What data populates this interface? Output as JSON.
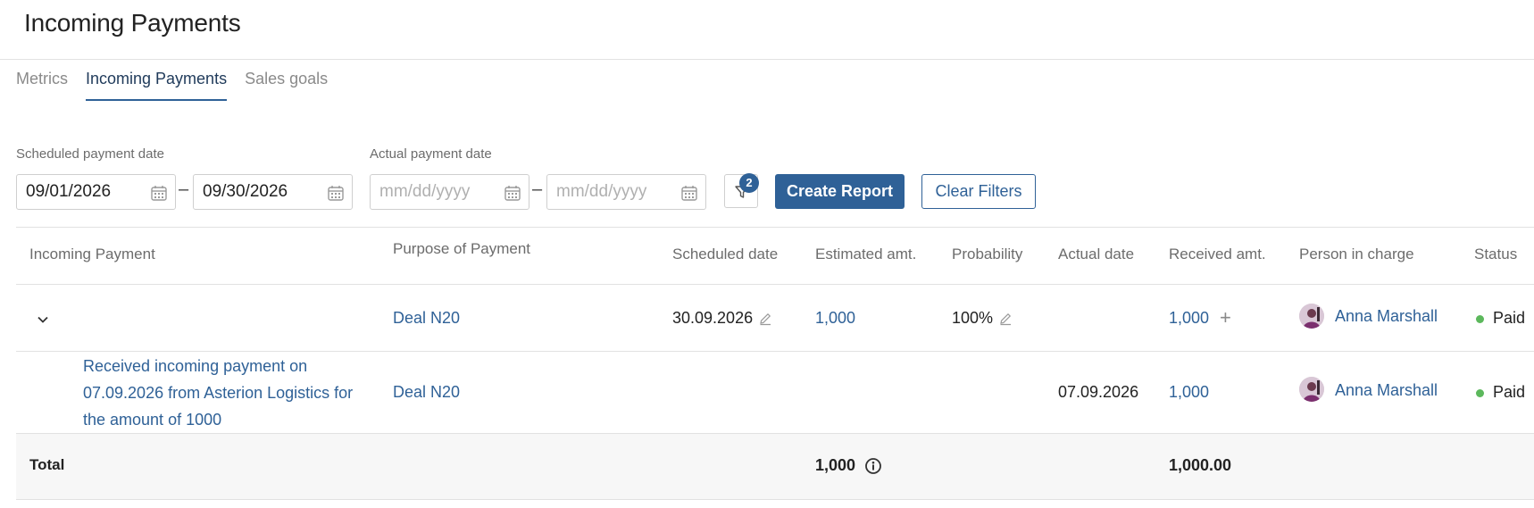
{
  "page": {
    "title": "Incoming Payments"
  },
  "tabs": [
    {
      "label": "Metrics"
    },
    {
      "label": "Incoming Payments",
      "active": true
    },
    {
      "label": "Sales goals"
    }
  ],
  "filters": {
    "scheduled_label": "Scheduled payment date",
    "scheduled_from": "09/01/2026",
    "scheduled_to": "09/30/2026",
    "actual_label": "Actual payment date",
    "actual_from_placeholder": "mm/dd/yyyy",
    "actual_to_placeholder": "mm/dd/yyyy",
    "separator": "–",
    "filter_count": "2",
    "create_report": "Create Report",
    "clear_filters": "Clear Filters"
  },
  "table": {
    "headers": {
      "incoming_payment": "Incoming Payment",
      "purpose": "Purpose of Payment",
      "scheduled_date": "Scheduled date",
      "estimated_amt": "Estimated amt.",
      "probability": "Probability",
      "actual_date": "Actual date",
      "received_amt": "Received amt.",
      "person": "Person in charge",
      "status": "Status"
    },
    "rows": [
      {
        "incoming_payment": "",
        "purpose": "Deal N20",
        "scheduled_date": "30.09.2026",
        "estimated_amt": "1,000",
        "probability": "100%",
        "actual_date": "",
        "received_amt": "1,000",
        "person": "Anna Marshall",
        "status": "Paid"
      },
      {
        "incoming_payment": "Received incoming payment on 07.09.2026 from Asterion Logistics for the amount of 1000",
        "purpose": "Deal N20",
        "scheduled_date": "",
        "estimated_amt": "",
        "probability": "",
        "actual_date": "07.09.2026",
        "received_amt": "1,000",
        "person": "Anna Marshall",
        "status": "Paid"
      }
    ],
    "total": {
      "label": "Total",
      "estimated_amt": "1,000",
      "received_amt": "1,000.00"
    }
  },
  "colors": {
    "accent": "#2f6197",
    "status_paid": "#5cb85c"
  },
  "icons": [
    "calendar-icon",
    "filter-icon",
    "pencil-icon",
    "plus-icon",
    "chevron-down-icon",
    "info-icon",
    "avatar"
  ]
}
